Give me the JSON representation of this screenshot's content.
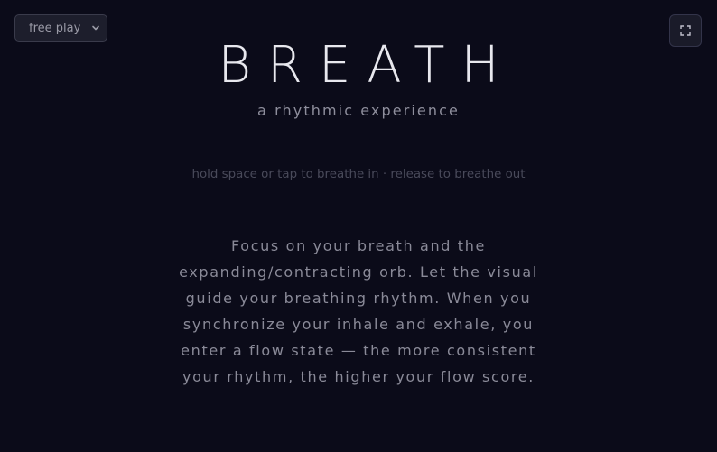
{
  "mode_select": {
    "selected": "free play"
  },
  "header": {
    "title": "BREATH",
    "subtitle": "a rhythmic experience"
  },
  "hint": "hold space or tap to breathe in · release to breathe out",
  "description": "Focus on your breath and the expanding/contracting orb. Let the visual guide your breathing rhythm. When you synchronize your inhale and exhale, you enter a flow state — the more consistent your rhythm, the higher your flow score.",
  "icons": {
    "mode_chevron": "chevron-down-icon",
    "fullscreen": "fullscreen-icon"
  },
  "colors": {
    "background": "#0b0b19",
    "title": "#e8e8ee",
    "muted_text": "#8a8a98",
    "hint_text": "#494a5a"
  }
}
